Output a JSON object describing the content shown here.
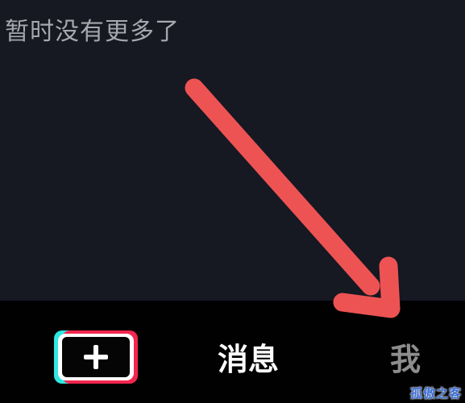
{
  "feed": {
    "empty_message": "暂时没有更多了"
  },
  "tab_bar": {
    "create_icon": "plus-icon",
    "messages_label": "消息",
    "me_label": "我"
  },
  "annotation": {
    "arrow_color": "#ee5353"
  },
  "watermark": {
    "text": "孤傲之客"
  },
  "colors": {
    "background": "#161822",
    "tab_bar_background": "#010101",
    "active_tab_text": "#ffffff",
    "inactive_tab_text": "#8d8d8d",
    "accent_cyan": "#2ee8e2",
    "accent_red": "#f3264f"
  }
}
